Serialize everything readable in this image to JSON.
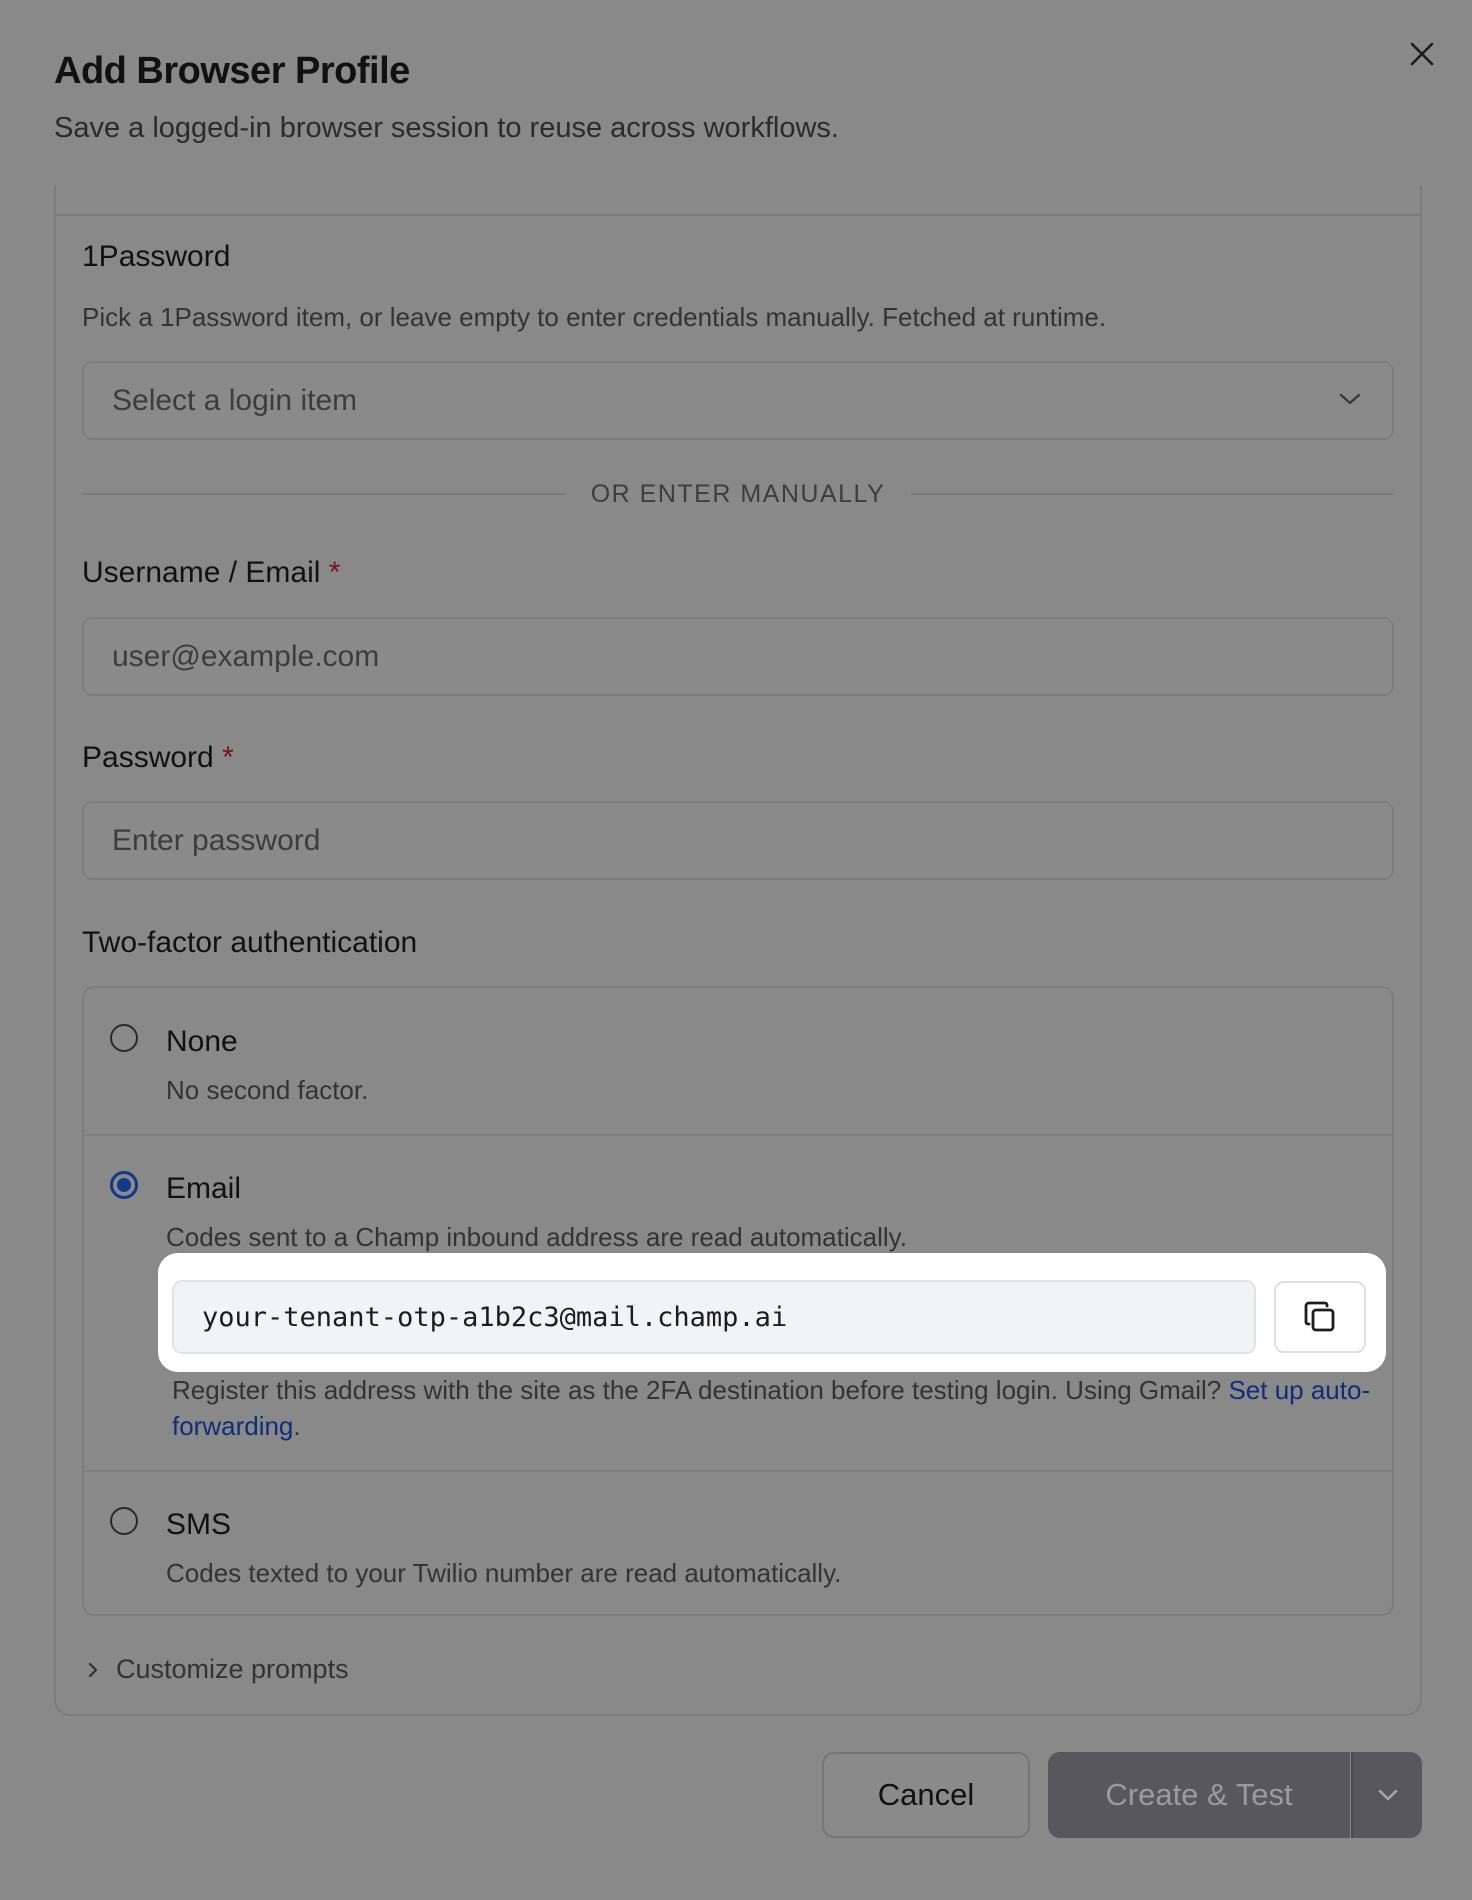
{
  "dialog": {
    "title": "Add Browser Profile",
    "subtitle": "Save a logged-in browser session to reuse across workflows.",
    "close_icon": "close-icon"
  },
  "onepassword": {
    "title": "1Password",
    "description": "Pick a 1Password item, or leave empty to enter credentials manually. Fetched at runtime.",
    "select_placeholder": "Select a login item"
  },
  "divider_text": "OR ENTER MANUALLY",
  "username": {
    "label": "Username / Email",
    "required_mark": "*",
    "placeholder": "user@example.com"
  },
  "password": {
    "label": "Password",
    "required_mark": "*",
    "placeholder": "Enter password"
  },
  "two_factor": {
    "title": "Two-factor authentication",
    "selected": "Email",
    "options": [
      {
        "label": "None",
        "description": "No second factor."
      },
      {
        "label": "Email",
        "description": "Codes sent to a Champ inbound address are read automatically."
      },
      {
        "label": "SMS",
        "description": "Codes texted to your Twilio number are read automatically."
      }
    ],
    "email_address": "your-tenant-otp-a1b2c3@mail.champ.ai",
    "help_text": "Register this address with the site as the 2FA destination before testing login. Using Gmail? ",
    "help_link": "Set up auto-forwarding",
    "help_suffix": "."
  },
  "customize_prompts": "Customize prompts",
  "footer": {
    "cancel": "Cancel",
    "create": "Create & Test"
  },
  "colors": {
    "accent": "#0f3a8a",
    "required": "#7a1414",
    "highlight": "#ffffff"
  }
}
